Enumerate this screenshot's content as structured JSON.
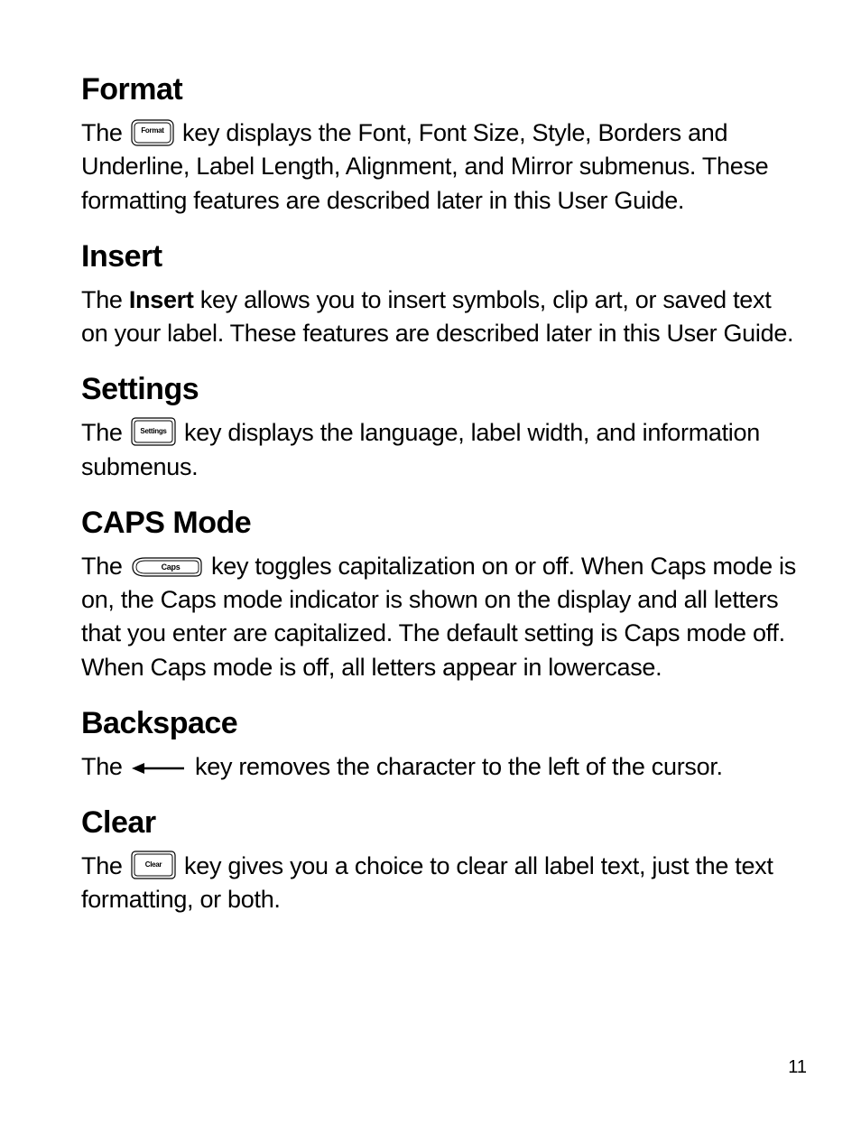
{
  "sections": {
    "format": {
      "heading": "Format",
      "text_before": "The ",
      "key_label": "Format",
      "text_after": " key displays the Font, Font Size, Style, Borders and Underline, Label Length, Alignment, and Mirror submenus. These formatting features are described later in this User Guide."
    },
    "insert": {
      "heading": "Insert",
      "text_before": "The ",
      "bold_word": "Insert",
      "text_after": " key allows you to insert symbols, clip art, or saved text on your label. These features are described later in this User Guide."
    },
    "settings": {
      "heading": "Settings",
      "text_before": "The ",
      "key_label": "Settings",
      "text_after": " key displays the language, label width, and information submenus."
    },
    "caps": {
      "heading": "CAPS Mode",
      "text_before": "The ",
      "key_label": "Caps",
      "text_after": " key toggles capitalization on or off. When Caps mode is on, the Caps mode indicator is shown on the display and all letters that you enter are capitalized. The default setting is Caps mode off. When Caps mode is off, all letters appear in lowercase."
    },
    "backspace": {
      "heading": "Backspace",
      "text_before": "The ",
      "text_after": " key removes the character to the left of the cursor."
    },
    "clear": {
      "heading": "Clear",
      "text_before": "The ",
      "key_label": "Clear",
      "text_after": " key gives you a choice to clear all label text, just the text formatting, or both."
    }
  },
  "page_number": "11"
}
